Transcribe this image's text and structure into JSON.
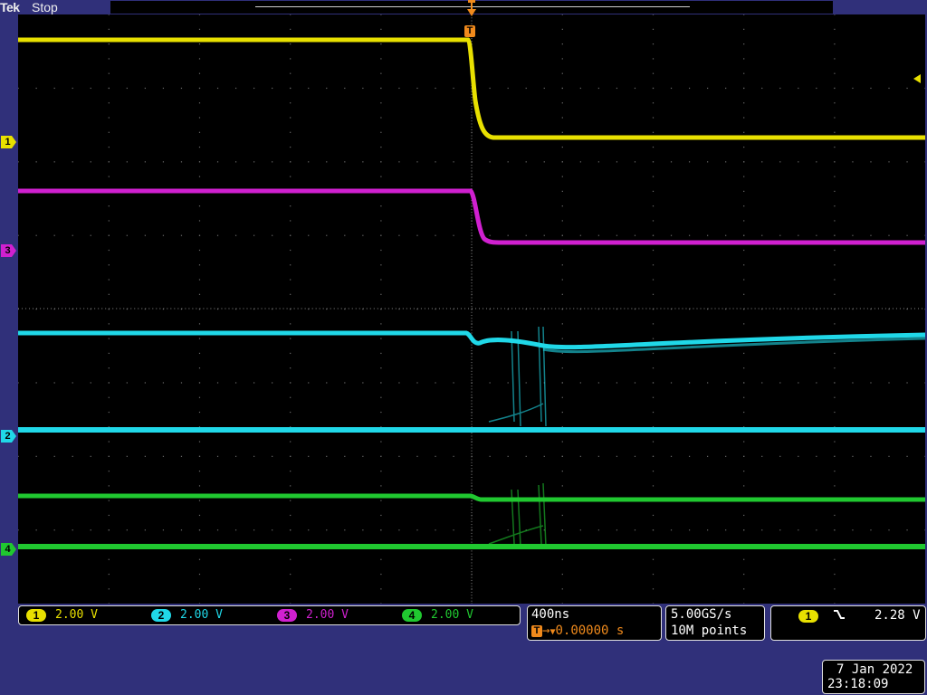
{
  "header": {
    "brand": "Tek",
    "run_state": "Stop",
    "trigger_position_label": "T"
  },
  "channels": [
    {
      "id": "1",
      "color": "#e8e000",
      "scale": "2.00 V"
    },
    {
      "id": "2",
      "color": "#20d8e8",
      "scale": "2.00 V"
    },
    {
      "id": "3",
      "color": "#d020d0",
      "scale": "2.00 V"
    },
    {
      "id": "4",
      "color": "#20c830",
      "scale": "2.00 V"
    }
  ],
  "timebase": {
    "scale": "400ns",
    "trigger_marker": "T",
    "delay": "0.00000 s"
  },
  "acquisition": {
    "sample_rate": "5.00GS/s",
    "record_length": "10M points"
  },
  "trigger": {
    "source": "1",
    "slope_icon": "falling-edge-icon",
    "level": "2.28 V"
  },
  "datetime": {
    "date": "7 Jan  2022",
    "time": "23:18:09"
  },
  "colors": {
    "background": "#30307a",
    "graticule": "#000000",
    "trigger_orange": "#f08a1c"
  }
}
